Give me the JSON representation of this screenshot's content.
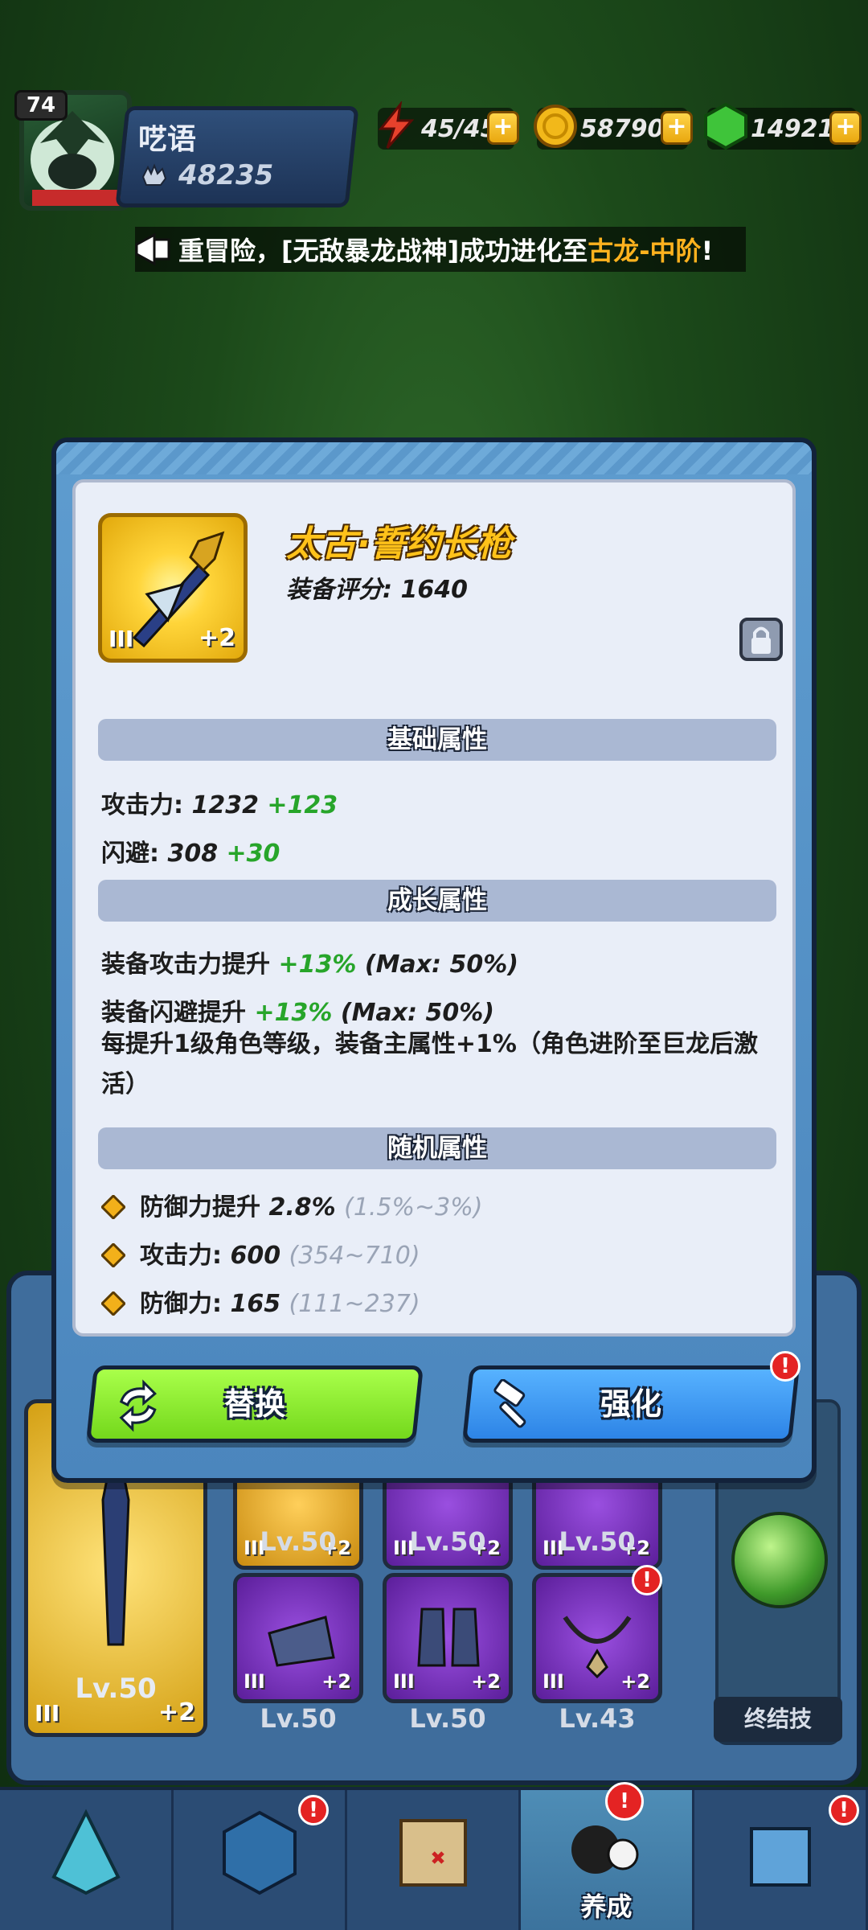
{
  "player": {
    "level": "74",
    "name": "呓语",
    "power": "48235"
  },
  "resources": [
    {
      "name": "energy",
      "value": "45/45",
      "icon": "lightning-icon",
      "color": "#e8412c"
    },
    {
      "name": "gold",
      "value": "58790",
      "icon": "coin-icon",
      "color": "#f2b81a"
    },
    {
      "name": "gems",
      "value": "14921",
      "icon": "gem-icon",
      "color": "#3fc43a"
    }
  ],
  "broadcast": {
    "prefix": "重冒险，[无敌暴龙战神]成功进化至",
    "highlight": "古龙-中阶",
    "suffix": "!"
  },
  "item": {
    "name": "太古·誓约长枪",
    "score_label": "装备评分: ",
    "score_value": "1640",
    "tier": "III",
    "enhance": "+2"
  },
  "sections": {
    "basic": "基础属性",
    "growth": "成长属性",
    "random": "随机属性"
  },
  "basic_attrs": [
    {
      "label": "攻击力: ",
      "value": "1232",
      "bonus": "+123"
    },
    {
      "label": "闪避: ",
      "value": "308",
      "bonus": "+30"
    }
  ],
  "growth_attrs": [
    {
      "label": "装备攻击力提升 ",
      "value": "+13%",
      "max": "(Max: 50%)"
    },
    {
      "label": "装备闪避提升 ",
      "value": "+13%",
      "max": "(Max: 50%)"
    }
  ],
  "growth_note": "每提升1级角色等级，装备主属性+1%（角色进阶至巨龙后激活）",
  "random_attrs": [
    {
      "label": "防御力提升 ",
      "value": "2.8%",
      "range": "(1.5%~3%)"
    },
    {
      "label": "攻击力: ",
      "value": "600",
      "range": "(354~710)"
    },
    {
      "label": "防御力: ",
      "value": "165",
      "range": "(111~237)"
    }
  ],
  "buttons": {
    "replace": "替换",
    "enhance": "强化",
    "badge": "!"
  },
  "equipment": {
    "main_level": "Lv.50",
    "slots": [
      {
        "level": "Lv.50",
        "tier": "III",
        "enhance": "+2"
      },
      {
        "level": "Lv.50",
        "tier": "III",
        "enhance": "+2"
      },
      {
        "level": "Lv.50",
        "tier": "III",
        "enhance": "+2"
      },
      {
        "level": "Lv.50",
        "tier": "III",
        "enhance": "+2"
      },
      {
        "level": "Lv.50",
        "tier": "III",
        "enhance": "+2"
      },
      {
        "level": "Lv.43",
        "tier": "III",
        "enhance": "+2"
      }
    ],
    "ultimate_label": "终结技"
  },
  "nav": [
    {
      "label": "",
      "icon": "crystal-icon"
    },
    {
      "label": "",
      "icon": "rune-shield-icon"
    },
    {
      "label": "",
      "icon": "map-icon"
    },
    {
      "label": "养成",
      "icon": "character-icon"
    },
    {
      "label": "",
      "icon": "shop-icon"
    }
  ]
}
